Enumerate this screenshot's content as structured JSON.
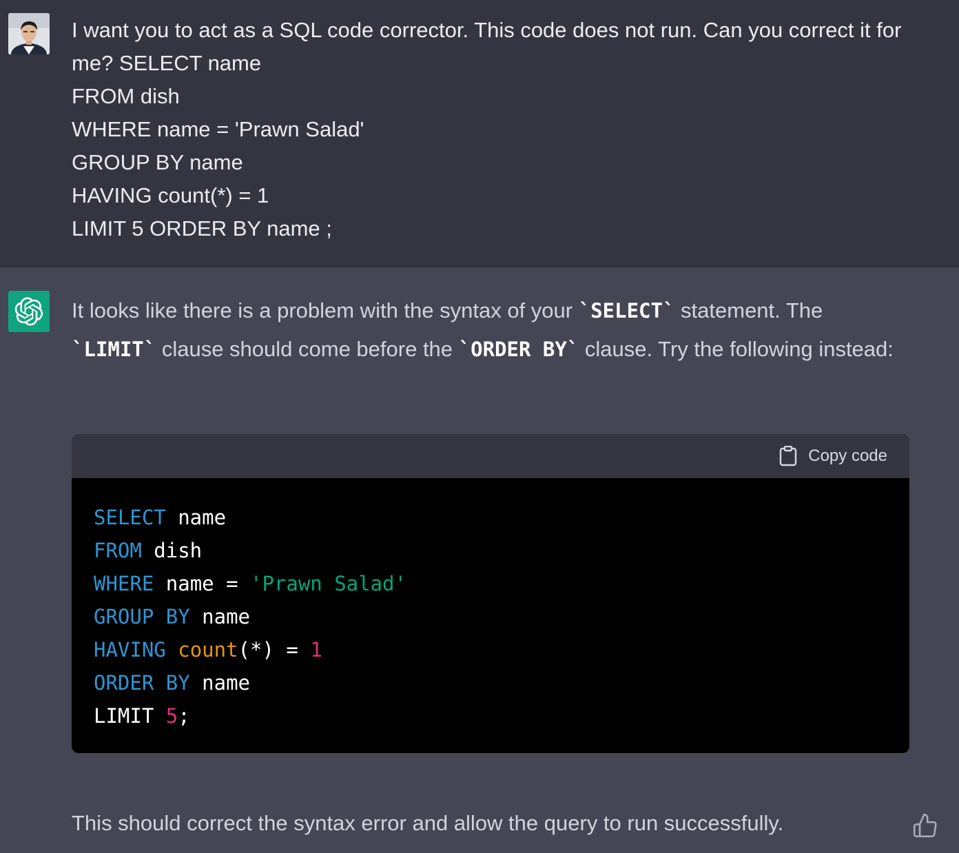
{
  "user": {
    "lines": [
      "I want you to act as a SQL code corrector. This code does not run. Can you correct it for",
      "me? SELECT name",
      "FROM dish",
      "WHERE name = 'Prawn Salad'",
      "GROUP BY name",
      "HAVING count(*) = 1",
      "LIMIT 5 ORDER BY name ;"
    ]
  },
  "assistant": {
    "p1_a": "It looks like there is a problem with the syntax of your ",
    "p1_code1": "`SELECT`",
    "p1_b": " statement. The ",
    "p1_code2": "`LIMIT`",
    "p1_c": " clause should come before the ",
    "p1_code3": "`ORDER BY`",
    "p1_d": " clause. Try the following instead:",
    "copy_label": "Copy code",
    "code": {
      "l1_kw": "SELECT",
      "l1_rest": " name",
      "l2_kw": "FROM",
      "l2_rest": " dish",
      "l3_kw": "WHERE",
      "l3_mid": " name = ",
      "l3_str": "'Prawn Salad'",
      "l4_kw1": "GROUP",
      "l4_kw2": "BY",
      "l4_rest": " name",
      "l5_kw": "HAVING",
      "l5_fn": "count",
      "l5_mid": "(*) = ",
      "l5_num": "1",
      "l6_kw1": "ORDER",
      "l6_kw2": "BY",
      "l6_rest": " name",
      "l7_kw": "LIMIT ",
      "l7_num": "5",
      "l7_end": ";"
    },
    "closing": "This should correct the syntax error and allow the query to run successfully."
  },
  "colors": {
    "user_bg": "#343541",
    "assistant_bg": "#444654",
    "gpt_green": "#10a37f",
    "keyword": "#2e95d3",
    "string": "#00a67d",
    "function": "#e9950c",
    "number": "#df3079"
  },
  "icons": {
    "user_avatar": "user-photo",
    "assistant_avatar": "openai-logo-icon",
    "copy": "clipboard-icon",
    "feedback": "thumbs-up-icon"
  }
}
